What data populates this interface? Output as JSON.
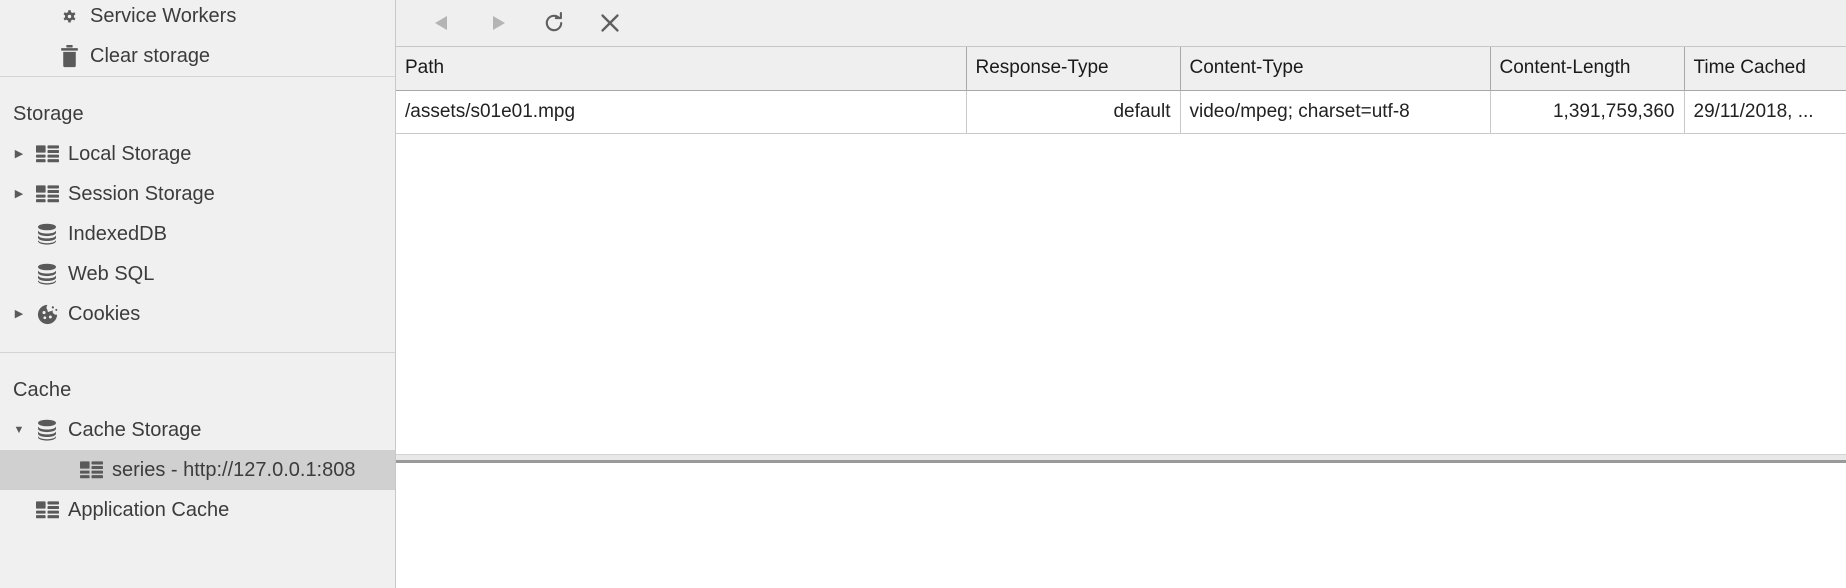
{
  "sidebar": {
    "application_section": {
      "items": [
        {
          "label": "Service Workers",
          "icon": "gear-icon",
          "twisty": "none",
          "indent": 2,
          "selected": false
        },
        {
          "label": "Clear storage",
          "icon": "trash-icon",
          "twisty": "none",
          "indent": 2,
          "selected": false
        }
      ]
    },
    "storage_section": {
      "title": "Storage",
      "items": [
        {
          "label": "Local Storage",
          "icon": "table-icon",
          "twisty": "collapsed",
          "indent": 1,
          "selected": false
        },
        {
          "label": "Session Storage",
          "icon": "table-icon",
          "twisty": "collapsed",
          "indent": 1,
          "selected": false
        },
        {
          "label": "IndexedDB",
          "icon": "database-icon",
          "twisty": "none",
          "indent": 1,
          "selected": false
        },
        {
          "label": "Web SQL",
          "icon": "database-icon",
          "twisty": "none",
          "indent": 1,
          "selected": false
        },
        {
          "label": "Cookies",
          "icon": "cookie-icon",
          "twisty": "collapsed",
          "indent": 1,
          "selected": false
        }
      ]
    },
    "cache_section": {
      "title": "Cache",
      "items": [
        {
          "label": "Cache Storage",
          "icon": "database-icon",
          "twisty": "expanded",
          "indent": 1,
          "selected": false
        },
        {
          "label": "series - http://127.0.0.1:808",
          "icon": "table-icon",
          "twisty": "none",
          "indent": 3,
          "selected": true
        },
        {
          "label": "Application Cache",
          "icon": "table-icon",
          "twisty": "none",
          "indent": 1,
          "selected": false
        }
      ]
    }
  },
  "toolbar": {
    "buttons": [
      {
        "name": "back-button",
        "icon": "triangle-left-icon",
        "label": "Back",
        "enabled": false
      },
      {
        "name": "forward-button",
        "icon": "triangle-right-icon",
        "label": "Forward",
        "enabled": false
      },
      {
        "name": "refresh-button",
        "icon": "refresh-icon",
        "label": "Refresh",
        "enabled": true
      },
      {
        "name": "delete-button",
        "icon": "close-icon",
        "label": "Delete Selected",
        "enabled": true
      }
    ]
  },
  "table": {
    "columns": [
      {
        "key": "path",
        "label": "Path",
        "align": "left"
      },
      {
        "key": "response_type",
        "label": "Response-Type",
        "align": "right"
      },
      {
        "key": "content_type",
        "label": "Content-Type",
        "align": "left"
      },
      {
        "key": "content_length",
        "label": "Content-Length",
        "align": "right"
      },
      {
        "key": "time_cached",
        "label": "Time Cached",
        "align": "left"
      }
    ],
    "rows": [
      {
        "path": "/assets/s01e01.mpg",
        "response_type": "default",
        "content_type": "video/mpeg; charset=utf-8",
        "content_length": "1,391,759,360",
        "time_cached": "29/11/2018, ..."
      }
    ]
  },
  "colors": {
    "sidebar_bg": "#f0f0f0",
    "selected_row_bg": "#d0d0d0",
    "header_bg": "#efefef",
    "text": "#3c3c3c",
    "icon": "#5a5a5a",
    "icon_disabled": "#b4b4b4",
    "border": "#c8c8c8"
  }
}
